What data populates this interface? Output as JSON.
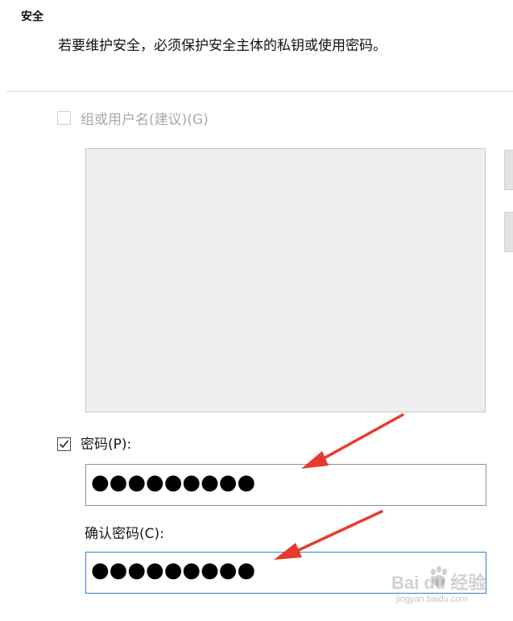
{
  "security": {
    "title": "安全",
    "description": "若要维护安全，必须保护安全主体的私钥或使用密码。"
  },
  "group_user": {
    "label": "组或用户名(建议)(G)",
    "checked": false,
    "enabled": false
  },
  "password": {
    "label": "密码(P):",
    "checked": true,
    "masked_value": "●●●●●●●●●"
  },
  "confirm_password": {
    "label": "确认密码(C):",
    "masked_value": "●●●●●●●●●"
  },
  "annotation": {
    "arrow_color": "#e8392f"
  },
  "watermark": {
    "text": "Bai du 经验",
    "url": "jingyan.baidu.com"
  }
}
